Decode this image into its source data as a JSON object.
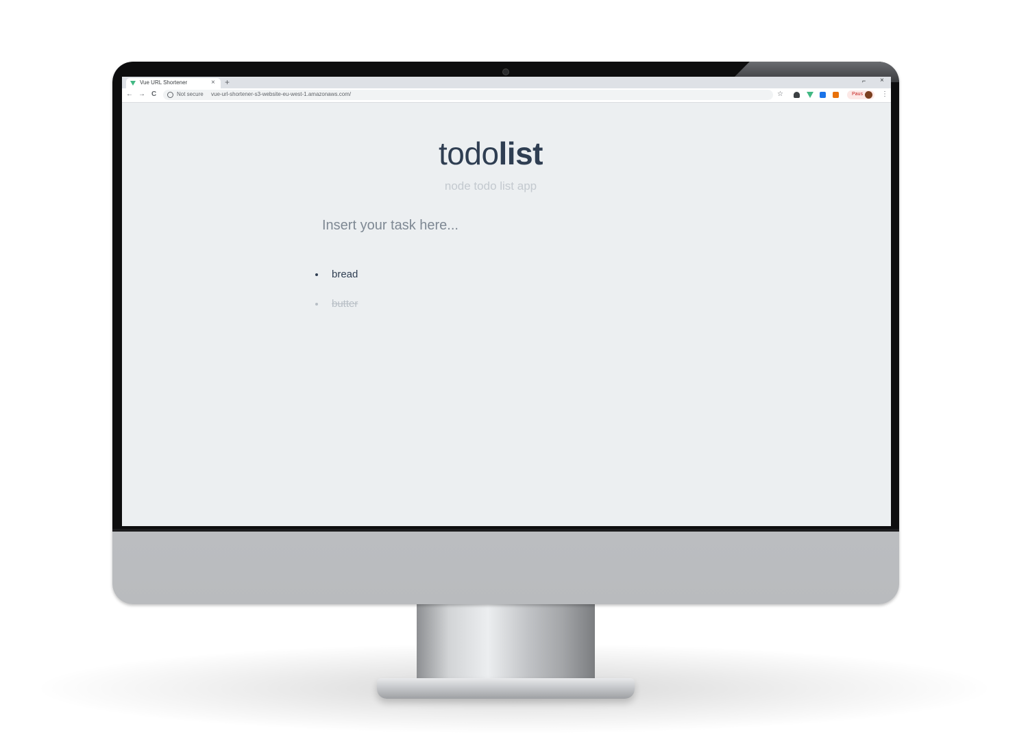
{
  "browser": {
    "tab_title": "Vue URL Shortener",
    "tab_close_icon": "×",
    "new_tab_icon": "+",
    "window_minimize_icon": "⌐",
    "window_close_icon": "×",
    "back_icon": "←",
    "forward_icon": "→",
    "reload_icon": "C",
    "security_label": "Not secure",
    "url": "vue-url-shortener-s3-website-eu-west-1.amazonaws.com/",
    "bookmark_icon": "☆",
    "profile_label": "Paus",
    "menu_icon": "⋮",
    "extension_colors": [
      "#3c4043",
      "#41b883",
      "#1a73e8",
      "#e8710a"
    ]
  },
  "app": {
    "title_light": "todo",
    "title_bold": "list",
    "subtitle": "node todo list app",
    "input_placeholder": "Insert your task here...",
    "input_value": "",
    "todos": [
      {
        "text": "bread",
        "done": false
      },
      {
        "text": "butter",
        "done": true
      }
    ]
  },
  "colors": {
    "page_background": "#eceff1",
    "title_color": "#2f3e52",
    "subtitle_color": "#c3c9cf",
    "done_color": "#b7bec5"
  }
}
